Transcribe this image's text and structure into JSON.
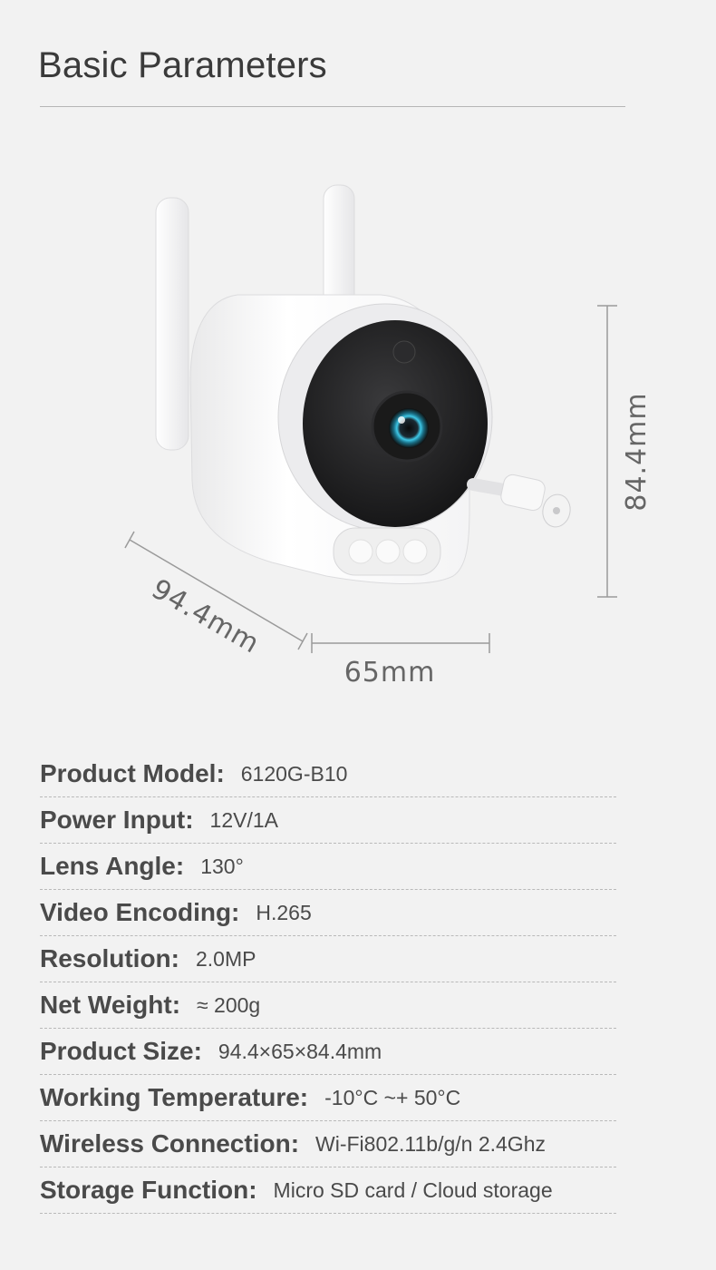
{
  "page": {
    "title": "Basic Parameters"
  },
  "dimensions": {
    "depth": "94.4mm",
    "width": "65mm",
    "height": "84.4mm"
  },
  "specs": [
    {
      "label": "Product Model:",
      "value": "6120G-B10"
    },
    {
      "label": "Power Input:",
      "value": "12V/1A"
    },
    {
      "label": "Lens Angle:",
      "value": "130°"
    },
    {
      "label": "Video Encoding:",
      "value": "H.265"
    },
    {
      "label": "Resolution:",
      "value": "2.0MP"
    },
    {
      "label": "Net Weight:",
      "value": "≈ 200g"
    },
    {
      "label": "Product Size:",
      "value": "94.4×65×84.4mm"
    },
    {
      "label": "Working Temperature:",
      "value": "-10°C ~+ 50°C"
    },
    {
      "label": "Wireless Connection:",
      "value": "Wi-Fi802.11b/g/n 2.4Ghz"
    },
    {
      "label": "Storage Function:",
      "value": "Micro SD card / Cloud storage"
    }
  ],
  "colors": {
    "background": "#f2f2f2",
    "text": "#4a4a4a",
    "camera_body": "#ffffff",
    "lens_face": "#222222",
    "lens_accent": "#3ec7e6"
  }
}
